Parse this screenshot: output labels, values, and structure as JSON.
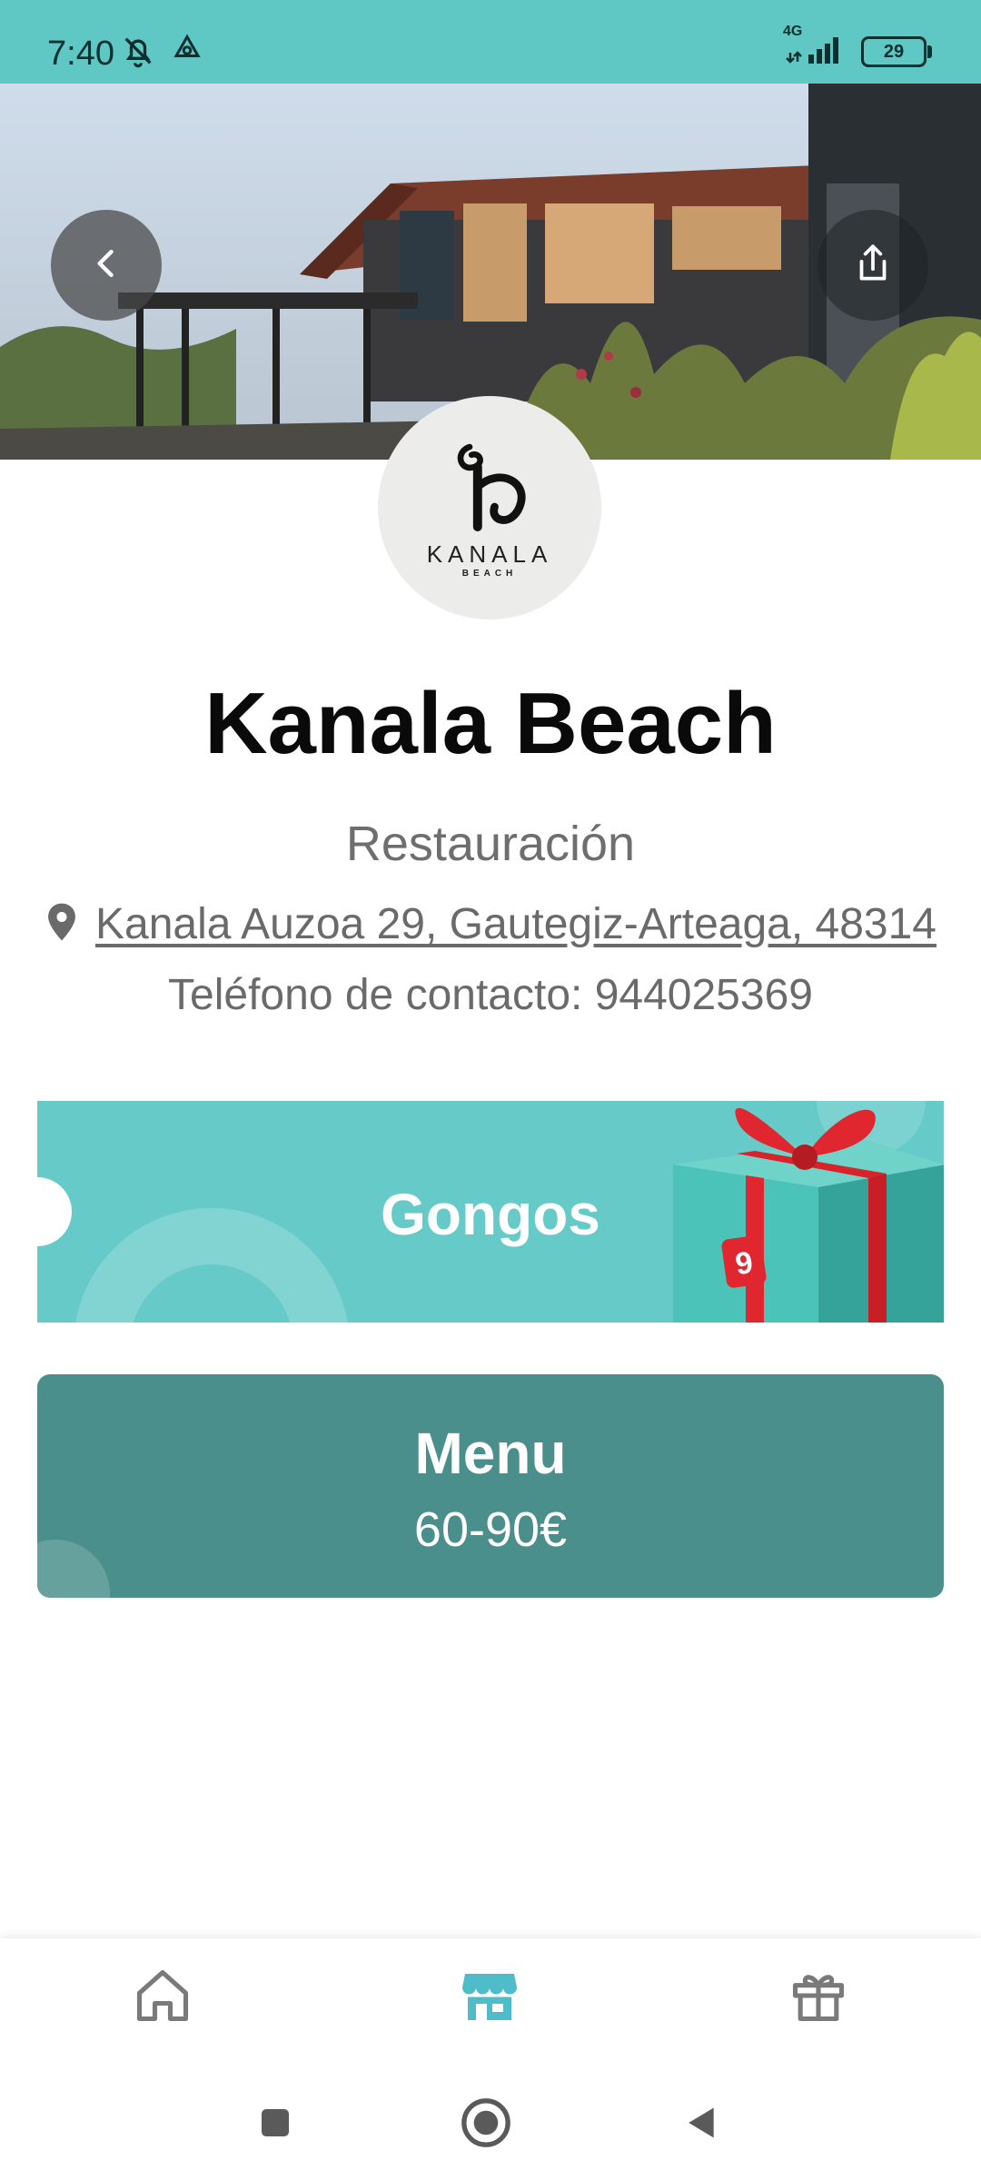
{
  "status_bar": {
    "time": "7:40",
    "network": "4G",
    "battery": "29",
    "icons": [
      "bell-off-icon",
      "tree-icon",
      "signal-icon",
      "battery-icon"
    ]
  },
  "hero": {
    "back_icon": "chevron-left-icon",
    "share_icon": "share-icon"
  },
  "logo": {
    "word": "KANALA",
    "sub": "BEACH"
  },
  "venue": {
    "name": "Kanala Beach",
    "category": "Restauración",
    "address_icon": "location-pin-icon",
    "address": "Kanala Auzoa 29, Gautegiz-Arteaga, 48314",
    "phone": "Teléfono de contacto: 944025369"
  },
  "gongos_card": {
    "label": "Gongos",
    "badge": "9",
    "art": "gift-box-icon"
  },
  "menu_card": {
    "title": "Menu",
    "price": "60-90€"
  },
  "bottom_nav": {
    "items": [
      {
        "icon": "home-icon",
        "active": false
      },
      {
        "icon": "store-icon",
        "active": true
      },
      {
        "icon": "gift-icon",
        "active": false
      }
    ]
  },
  "system_nav": [
    "recent-apps-icon",
    "home-circle-icon",
    "back-triangle-icon"
  ],
  "colors": {
    "accent": "#5fc8c5",
    "menu_card": "#4a8f8b",
    "nav_active": "#4fbdc9",
    "nav_inactive": "#7a7a7a"
  }
}
